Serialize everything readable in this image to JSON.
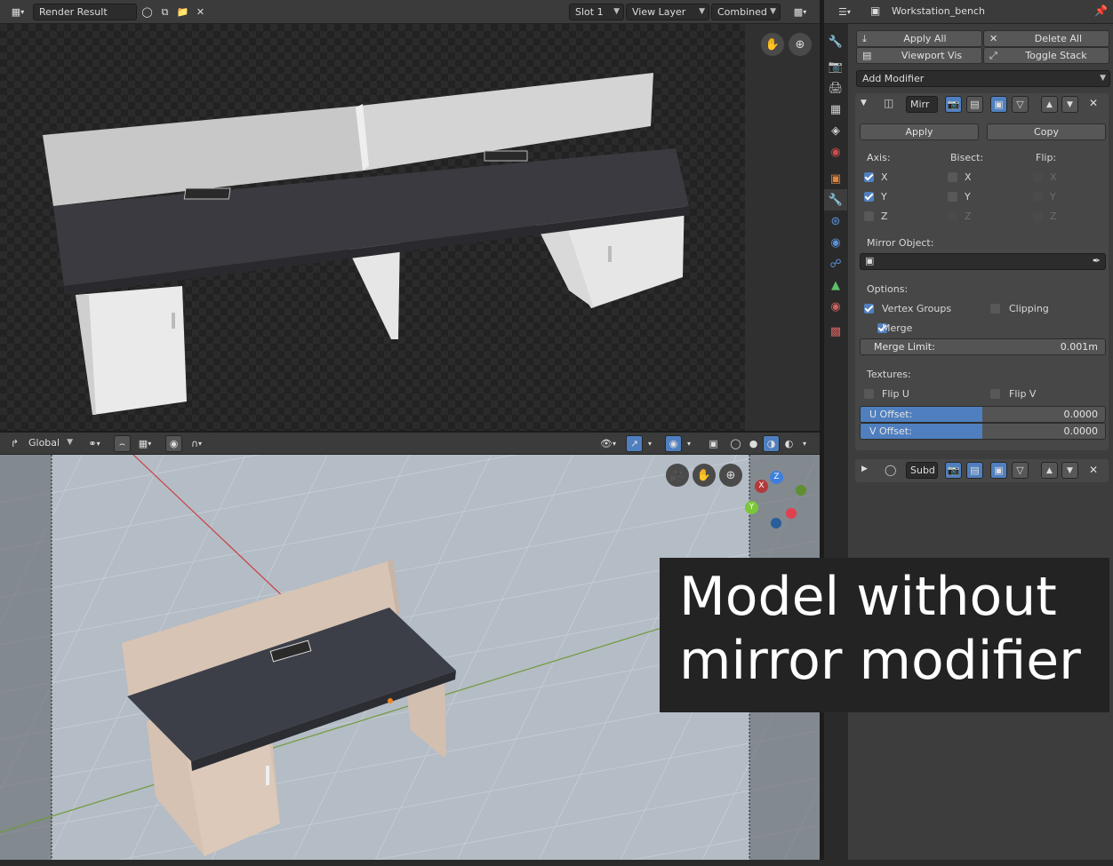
{
  "image_editor": {
    "image_name": "Render Result",
    "slot": "Slot 1",
    "view_layer": "View Layer",
    "pass": "Combined"
  },
  "viewport_header": {
    "orientation": "Global"
  },
  "properties": {
    "object_name": "Workstation_bench",
    "apply_all": "Apply All",
    "delete_all": "Delete All",
    "viewport_vis": "Viewport Vis",
    "toggle_stack": "Toggle Stack",
    "add_modifier": "Add Modifier",
    "mirror": {
      "name": "Mirr",
      "apply": "Apply",
      "copy": "Copy",
      "axis_label": "Axis:",
      "bisect_label": "Bisect:",
      "flip_label": "Flip:",
      "axes": [
        {
          "label": "X",
          "axis": true,
          "bisect": false,
          "flip": false
        },
        {
          "label": "Y",
          "axis": true,
          "bisect": false,
          "flip": false
        },
        {
          "label": "Z",
          "axis": false,
          "bisect": false,
          "flip": false
        }
      ],
      "mirror_object_label": "Mirror Object:",
      "options_label": "Options:",
      "vertex_groups": "Vertex Groups",
      "clipping": "Clipping",
      "merge": "Merge",
      "merge_limit_label": "Merge Limit:",
      "merge_limit_value": "0.001m",
      "textures_label": "Textures:",
      "flip_u": "Flip U",
      "flip_v": "Flip V",
      "u_offset_label": "U Offset:",
      "u_offset_value": "0.0000",
      "v_offset_label": "V Offset:",
      "v_offset_value": "0.0000"
    },
    "subsurf": {
      "name": "Subd"
    }
  },
  "gizmo": {
    "x": "X",
    "y": "Y",
    "z": "Z"
  },
  "caption": {
    "line1": "Model without",
    "line2": "mirror modifier"
  },
  "colors": {
    "accent_blue": "#4f7fbf",
    "panel_bg": "#3d3d3d",
    "caption_bg": "#232323"
  }
}
